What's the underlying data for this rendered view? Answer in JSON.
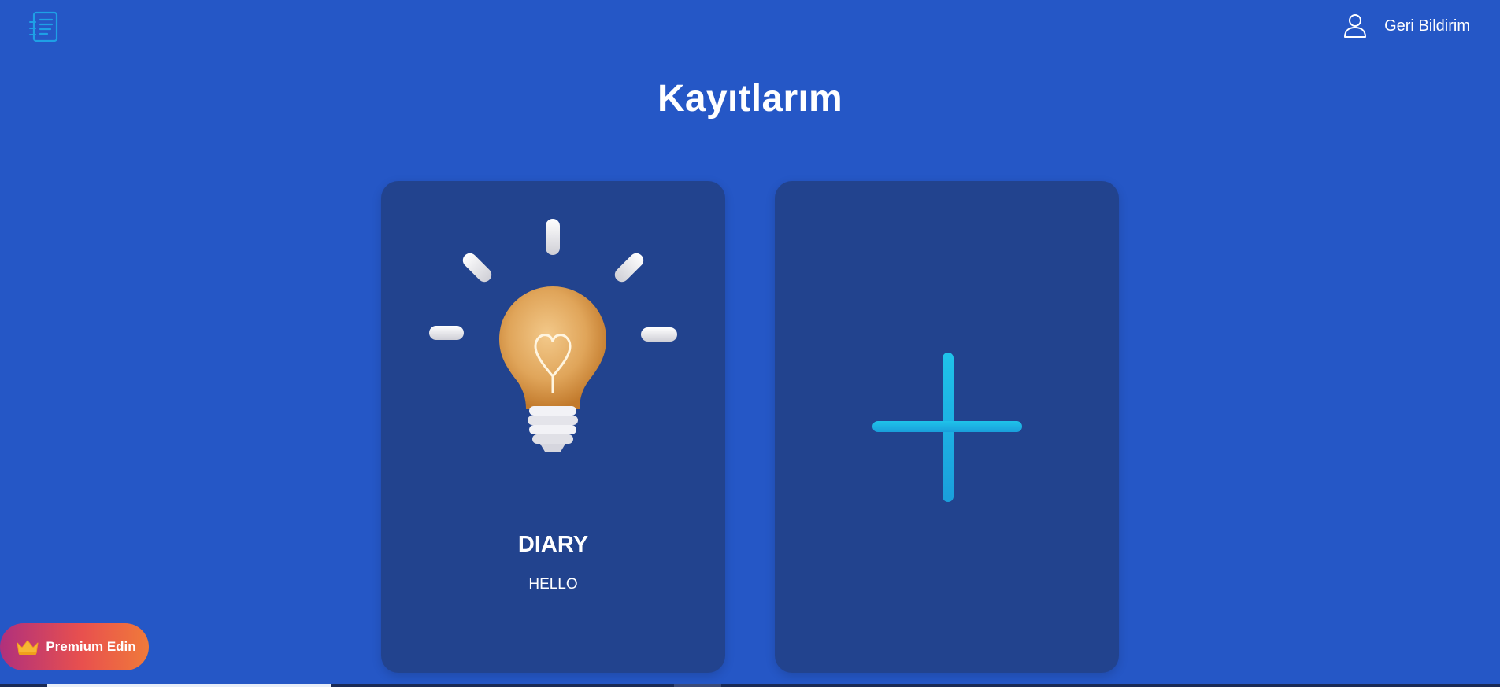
{
  "header": {
    "logo_icon": "notes-list-icon",
    "user_icon": "user-icon",
    "feedback_label": "Geri Bildirim"
  },
  "page": {
    "title": "Kayıtlarım"
  },
  "cards": [
    {
      "image_icon": "lightbulb-icon",
      "title": "DIARY",
      "subtitle": "HELLO"
    }
  ],
  "add_card": {
    "icon": "plus-icon"
  },
  "premium": {
    "icon": "crown-icon",
    "label": "Premium Edin"
  },
  "colors": {
    "background": "#2557c6",
    "card": "#22438e",
    "accent": "#1ea8e0"
  }
}
